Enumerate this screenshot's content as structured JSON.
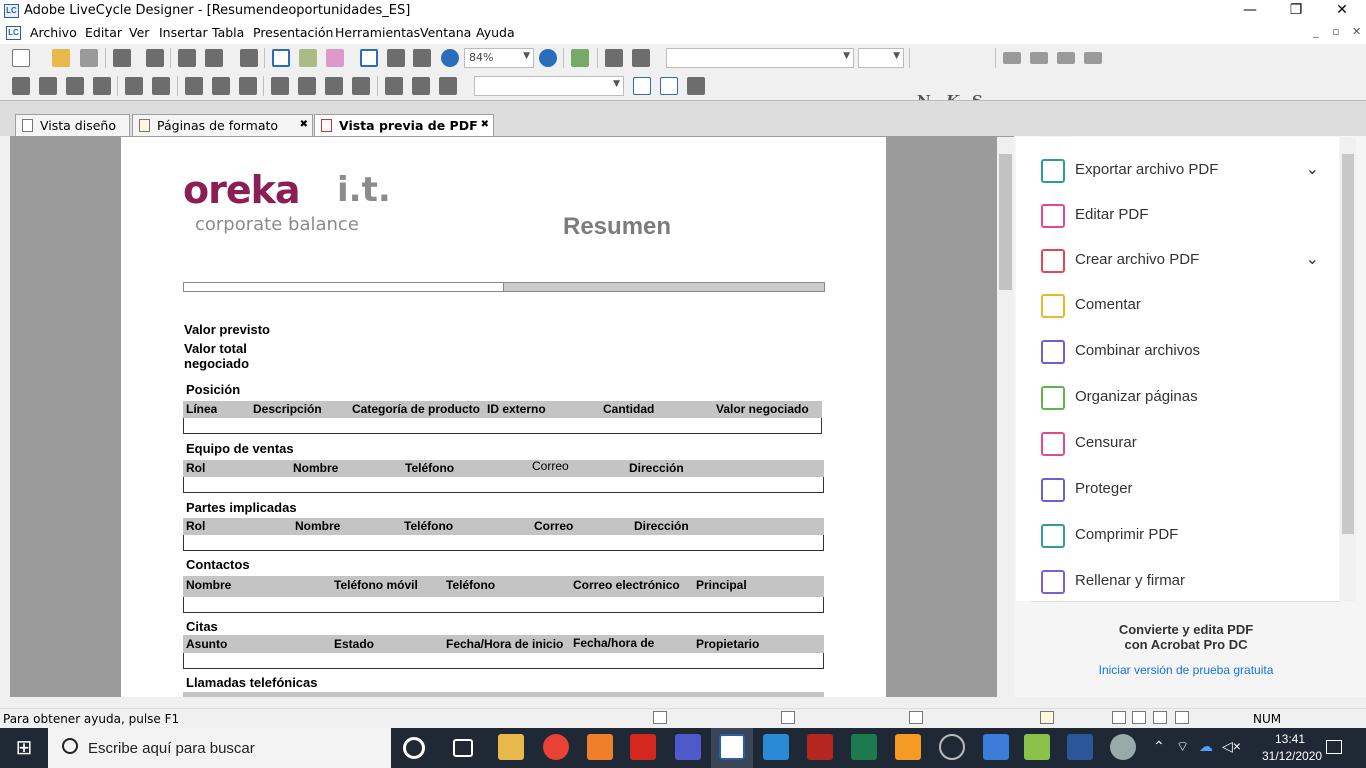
{
  "window": {
    "title": "Adobe LiveCycle Designer - [Resumendeoportunidades_ES]",
    "app_icon": "LC",
    "controls": {
      "minimize": "—",
      "restore": "❐",
      "close": "✕"
    }
  },
  "menubar": {
    "items": [
      "Archivo",
      "Editar",
      "Ver",
      "Insertar",
      "Tabla",
      "Presentación",
      "Herramientas",
      "Ventana",
      "Ayuda"
    ],
    "mdi_controls": {
      "minimize": "_",
      "restore": "▫",
      "close": "✕"
    }
  },
  "toolbar": {
    "zoom": "84%"
  },
  "tabs": [
    {
      "label": "Vista diseño",
      "active": false
    },
    {
      "label": "Páginas de formato",
      "active": false,
      "close": "✖"
    },
    {
      "label": "Vista previa de PDF",
      "active": true,
      "close": "✖"
    }
  ],
  "document": {
    "logo": {
      "main": "oreka",
      "suffix": "i.t.",
      "tagline": "corporate balance",
      "colors": {
        "main": "#8b1f55",
        "secondary": "#8b8b8b"
      }
    },
    "title": "Resumen",
    "progress_fraction": 0.5,
    "fields": [
      "Valor previsto",
      "Valor total",
      "negociado"
    ],
    "sections": [
      {
        "title": "Posición",
        "columns": [
          "Línea",
          "Descripción",
          "Categoría de producto",
          "ID externo",
          "Cantidad",
          "Valor negociado"
        ]
      },
      {
        "title": "Equipo de ventas",
        "columns": [
          "Rol",
          "Nombre",
          "Teléfono",
          "Correo",
          "Dirección"
        ]
      },
      {
        "title": "Partes implicadas",
        "columns": [
          "Rol",
          "Nombre",
          "Teléfono",
          "Correo",
          "Dirección"
        ]
      },
      {
        "title": "Contactos",
        "columns": [
          "Nombre",
          "Teléfono móvil",
          "Teléfono",
          "Correo electrónico",
          "Principal"
        ]
      },
      {
        "title": "Citas",
        "columns": [
          "Asunto",
          "Estado",
          "Fecha/Hora de inicio",
          "Fecha/hora de",
          "Propietario"
        ]
      },
      {
        "title": "Llamadas telefónicas",
        "columns": []
      }
    ]
  },
  "right_panel": {
    "tools": [
      {
        "label": "Exportar archivo PDF",
        "icon": "export-pdf-icon",
        "color": "#2d9b9f",
        "chevron": "⌄"
      },
      {
        "label": "Editar PDF",
        "icon": "edit-pdf-icon",
        "color": "#e34a8b"
      },
      {
        "label": "Crear archivo PDF",
        "icon": "create-pdf-icon",
        "color": "#e34850",
        "chevron": "⌄"
      },
      {
        "label": "Comentar",
        "icon": "comment-icon",
        "color": "#e9b92a"
      },
      {
        "label": "Combinar archivos",
        "icon": "combine-icon",
        "color": "#6d5fd6"
      },
      {
        "label": "Organizar páginas",
        "icon": "organize-icon",
        "color": "#61b34a"
      },
      {
        "label": "Censurar",
        "icon": "redact-icon",
        "color": "#e34a8b"
      },
      {
        "label": "Proteger",
        "icon": "protect-icon",
        "color": "#6d5fd6"
      },
      {
        "label": "Comprimir PDF",
        "icon": "compress-icon",
        "color": "#2d9b9f"
      },
      {
        "label": "Rellenar y firmar",
        "icon": "fill-sign-icon",
        "color": "#7a5fd6"
      }
    ],
    "promo_line1": "Convierte y edita PDF",
    "promo_line2": "con Acrobat Pro DC",
    "promo_link": "Iniciar versión de prueba gratuita"
  },
  "statusbar": {
    "help": "Para obtener ayuda, pulse F1",
    "num": "NUM"
  },
  "taskbar": {
    "search_placeholder": "Escribe aquí para buscar",
    "time": "13:41",
    "date": "31/12/2020"
  }
}
